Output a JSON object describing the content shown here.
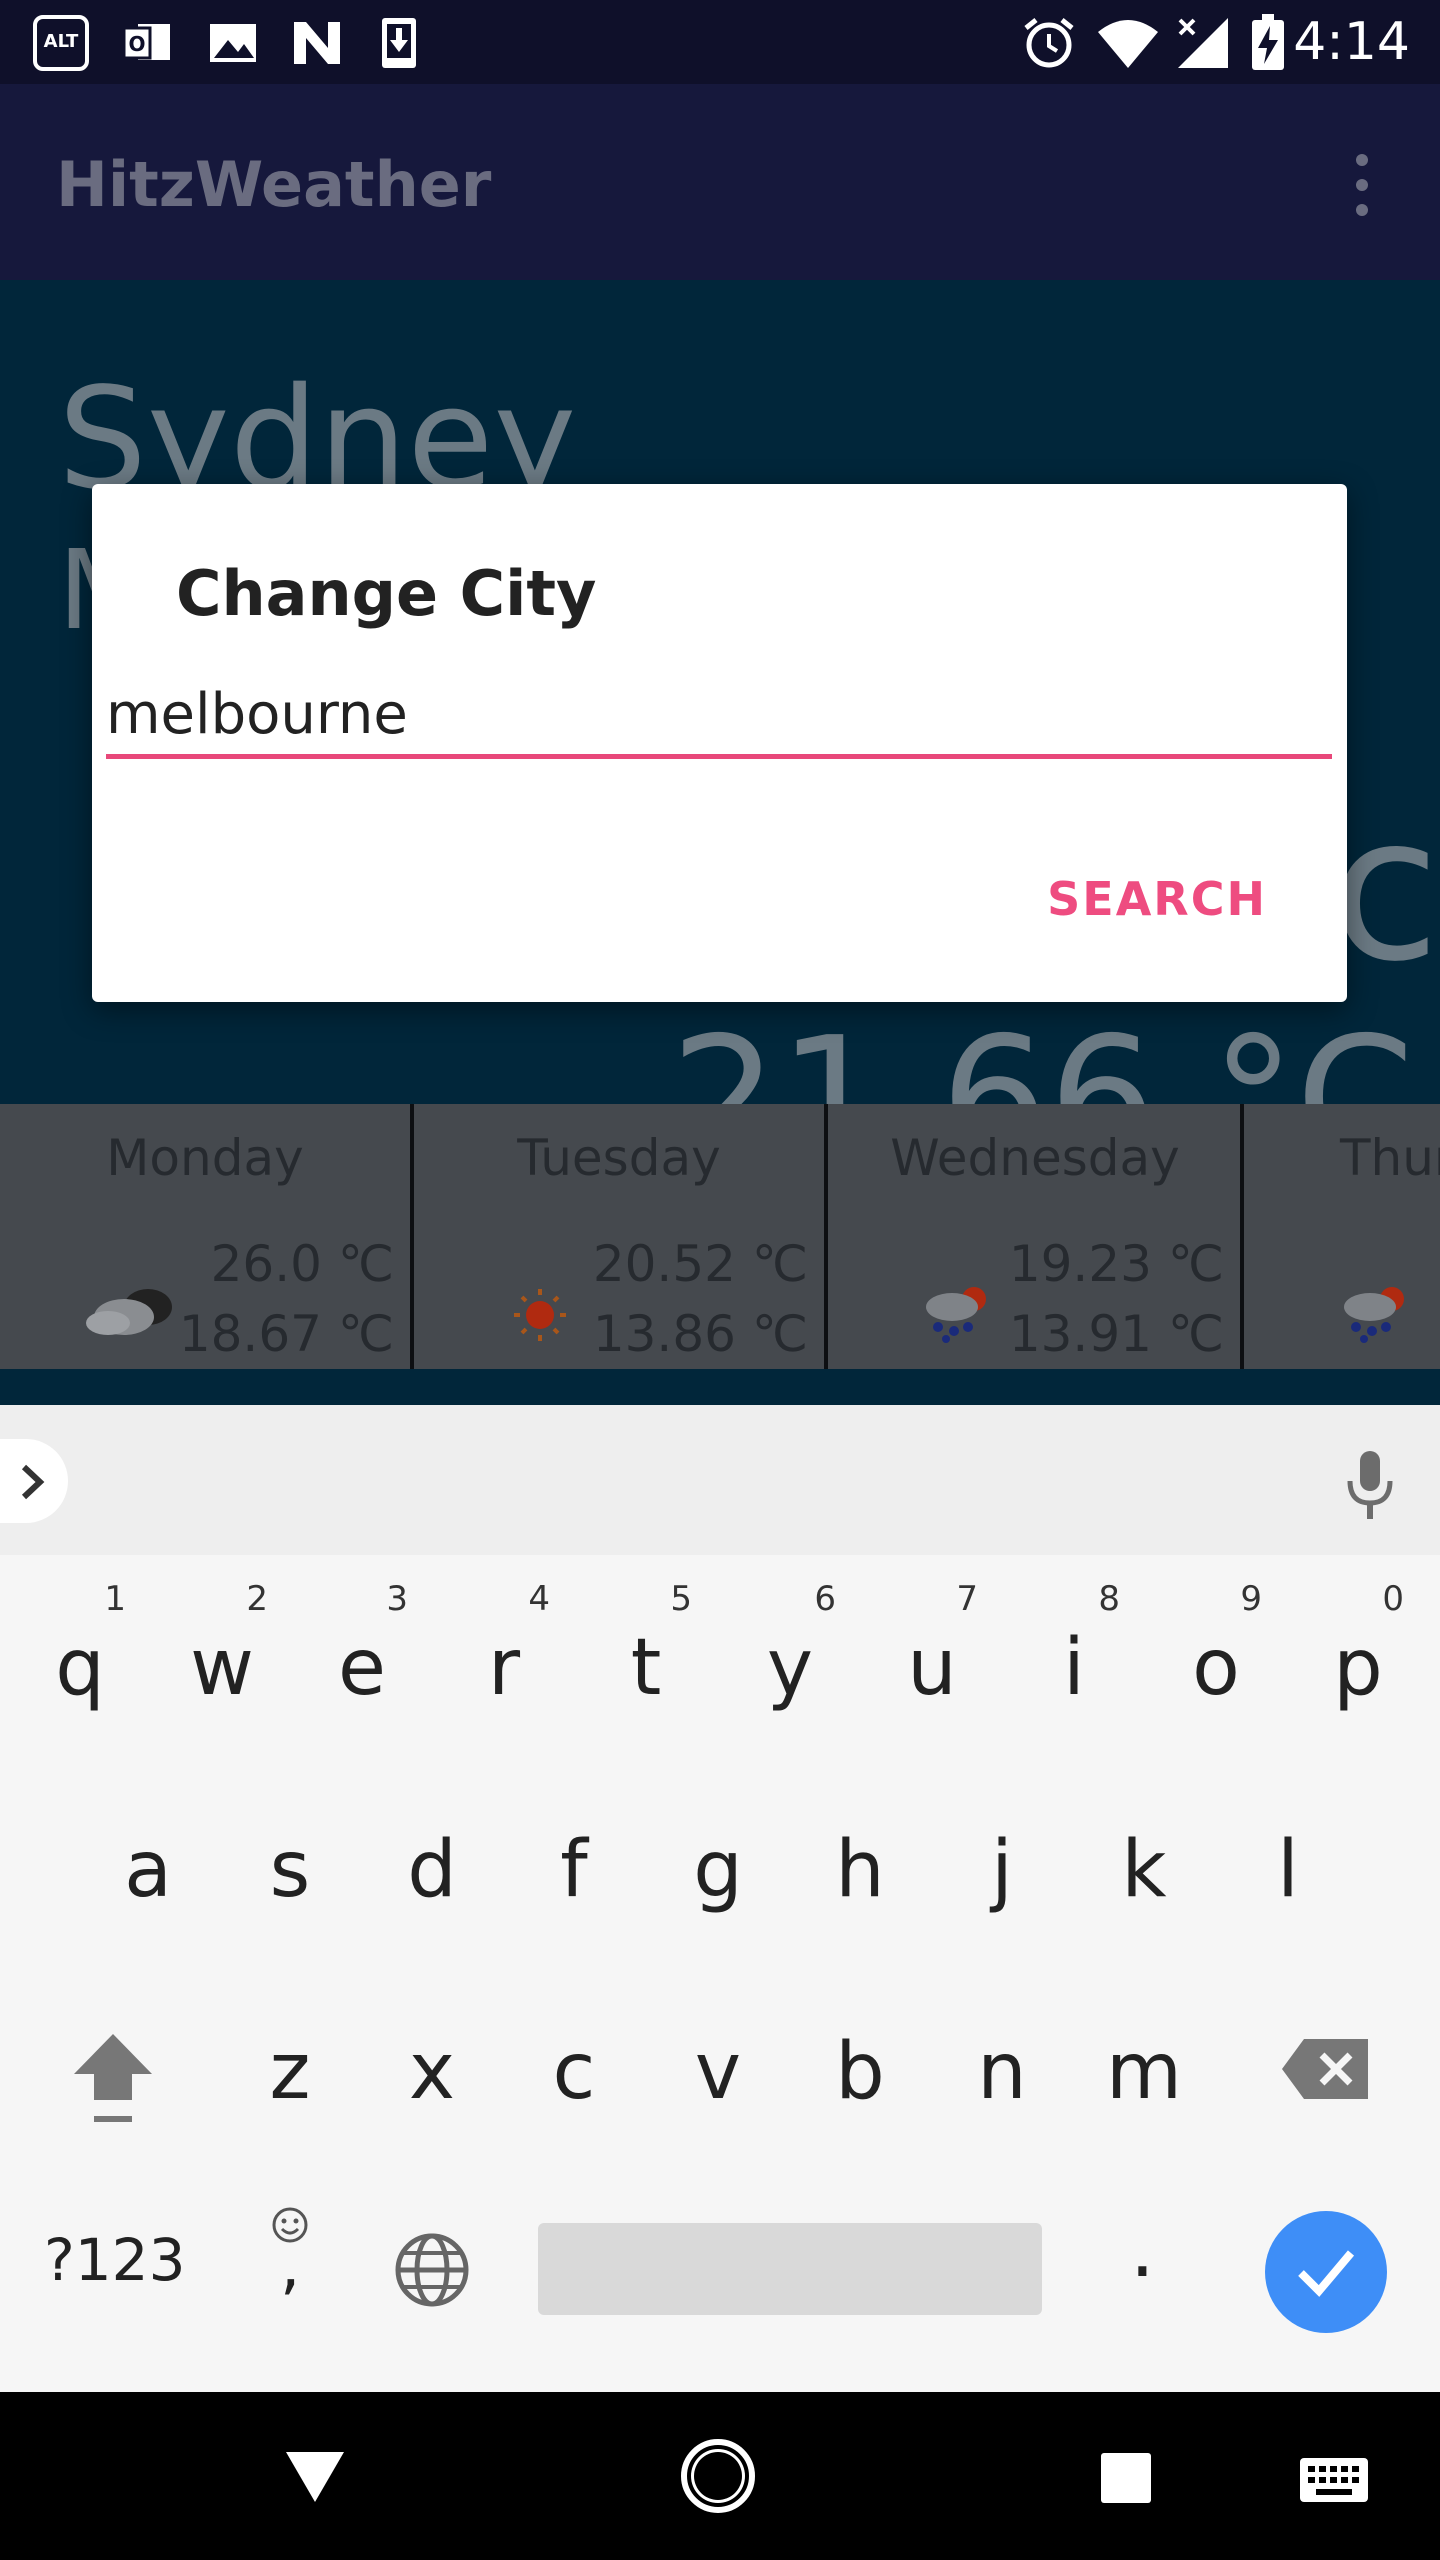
{
  "status_bar": {
    "time": "4:14",
    "left_icons": [
      "alt-balaji-icon",
      "outlook-icon",
      "image-icon",
      "n-logo-icon",
      "download-icon"
    ],
    "right_icons": [
      "alarm-icon",
      "wifi-icon",
      "signal-icon",
      "battery-charging-icon"
    ]
  },
  "app_bar": {
    "title": "HitzWeather"
  },
  "weather": {
    "city": "Sydney",
    "subtitle": "M",
    "current_temp": "21.66 °C",
    "big_unit_glyph": "c",
    "forecast": [
      {
        "day": "Monday",
        "high": "26.0 ℃",
        "low": "18.67 ℃",
        "icon": "cloudy-icon"
      },
      {
        "day": "Tuesday",
        "high": "20.52 ℃",
        "low": "13.86 ℃",
        "icon": "sunny-icon"
      },
      {
        "day": "Wednesday",
        "high": "19.23 ℃",
        "low": "13.91 ℃",
        "icon": "rain-sun-icon"
      },
      {
        "day": "Thur",
        "high": "",
        "low": "",
        "icon": "rain-sun-icon"
      }
    ]
  },
  "dialog": {
    "title": "Change City",
    "input_value": "melbourne",
    "search_label": "SEARCH"
  },
  "keyboard": {
    "row1": [
      {
        "k": "q",
        "n": "1"
      },
      {
        "k": "w",
        "n": "2"
      },
      {
        "k": "e",
        "n": "3"
      },
      {
        "k": "r",
        "n": "4"
      },
      {
        "k": "t",
        "n": "5"
      },
      {
        "k": "y",
        "n": "6"
      },
      {
        "k": "u",
        "n": "7"
      },
      {
        "k": "i",
        "n": "8"
      },
      {
        "k": "o",
        "n": "9"
      },
      {
        "k": "p",
        "n": "0"
      }
    ],
    "row2": [
      "a",
      "s",
      "d",
      "f",
      "g",
      "h",
      "j",
      "k",
      "l"
    ],
    "row3": [
      "z",
      "x",
      "c",
      "v",
      "b",
      "n",
      "m"
    ],
    "symbols_label": "?123",
    "comma": ",",
    "period": "."
  },
  "colors": {
    "accent": "#ee4c80",
    "enter_key": "#3e8ef7",
    "app_bar": "#16183c",
    "main_bg": "#01263a"
  }
}
